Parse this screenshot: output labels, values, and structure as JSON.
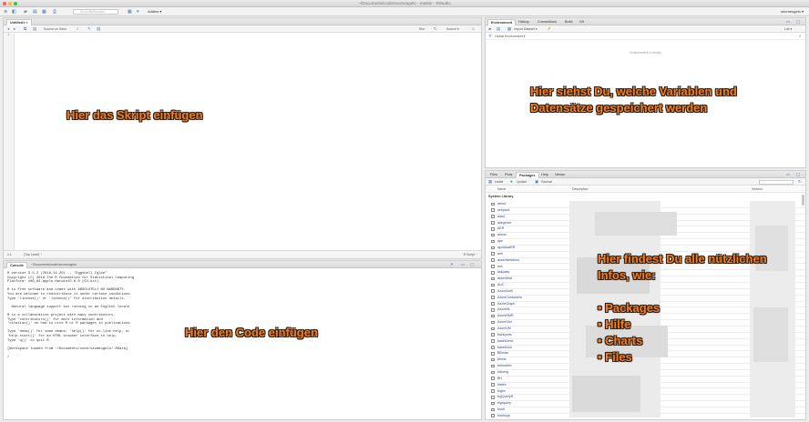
{
  "window": {
    "title": "~/Documents/code/seomeugelo - master - RStudio"
  },
  "toolbar": {
    "goto_placeholder": "Go to file/function",
    "addins": "Addins ▾",
    "project": "seomeugelo ▾"
  },
  "source": {
    "tab": "Untitled1 ×",
    "source_on_save": "Source on Save",
    "run": "Run",
    "source_btn": "Source ▾",
    "line1": "1",
    "status_pos": "1:1",
    "status_level": "(Top Level) ÷",
    "status_type": "R Script ÷"
  },
  "console": {
    "tab": "Console",
    "path": "~/Documents/code/seomeugelo/",
    "text": "R version 3.5.2 (2018-12-20) -- \"Eggshell Igloo\"\nCopyright (C) 2018 The R Foundation for Statistical Computing\nPlatform: x86_64-apple-darwin15.6.0 (64-bit)\n\nR is free software and comes with ABSOLUTELY NO WARRANTY.\nYou are welcome to redistribute it under certain conditions.\nType 'license()' or 'licence()' for distribution details.\n\n  Natural language support but running in an English locale\n\nR is a collaborative project with many contributors.\nType 'contributors()' for more information and\n'citation()' on how to cite R or R packages in publications.\n\nType 'demo()' for some demos, 'help()' for on-line help, or\n'help.start()' for an HTML browser interface to help.\nType 'q()' to quit R.\n\n[Workspace loaded from ~/Documents/code/seomeugelo/.RData]\n\n>"
  },
  "environment": {
    "tabs": [
      "Environment",
      "History",
      "Connections",
      "Build",
      "Git"
    ],
    "import_dataset": "Import Dataset ▾",
    "list": "List ▾",
    "global_env": "Global Environment ▾",
    "empty_msg": "Environment is empty"
  },
  "files": {
    "tabs": [
      "Files",
      "Plots",
      "Packages",
      "Help",
      "Viewer"
    ],
    "install": "Install",
    "update": "Update",
    "packrat": "Packrat",
    "col_name": "Name",
    "col_desc": "Description",
    "col_version": "Version",
    "section": "System Library",
    "packages": [
      "abind",
      "acepack",
      "ada4",
      "adegenet",
      "AER",
      "akima",
      "ape",
      "apollowaRR",
      "arm",
      "assertivedetect",
      "ash",
      "askpass",
      "assertthat",
      "AUC",
      "AzureAuth",
      "AzureContainers",
      "AzureGraph",
      "AzureML",
      "AzureRMR",
      "AzureStor",
      "AzureVM",
      "backports",
      "base64enc",
      "base64url",
      "BBmisc",
      "bbmle",
      "bdsmatrix",
      "bdsmrg",
      "BH",
      "bibtex",
      "biglm",
      "bigQueryR",
      "bigrquery",
      "bindr",
      "bindrcpp"
    ]
  },
  "annotations": {
    "script": "Hier das Skript einfügen",
    "code": "Hier den Code einfügen",
    "env_line1": "Hier siehst Du, welche Variablen und",
    "env_line2": "Datensätze gespeichert werden",
    "info_line1": "Hier findest Du alle nützlichen",
    "info_line2": "Infos, wie:",
    "bullets": [
      "• Packages",
      "• Hilfe",
      "• Charts",
      "• Files"
    ]
  }
}
